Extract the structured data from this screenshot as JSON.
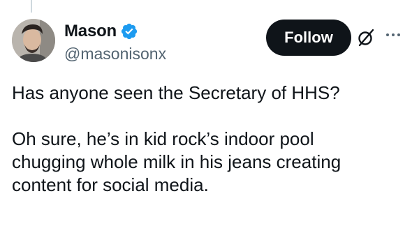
{
  "author": {
    "display_name": "Mason",
    "handle": "@masonisonx",
    "verified": true
  },
  "actions": {
    "follow_label": "Follow"
  },
  "icons": {
    "verified": "verified-badge-icon",
    "grok": "grok-icon",
    "more": "more-horizontal-icon"
  },
  "tweet": {
    "paragraph1": [
      "Has anyone seen the Secretary of HHS?"
    ],
    "paragraph2": [
      "Oh sure, he’s in kid rock’s indoor pool",
      "chugging whole milk in his jeans creating",
      "content for social media."
    ]
  },
  "colors": {
    "text": "#0f1419",
    "secondary": "#536471",
    "verified": "#1d9bf0",
    "button_bg": "#0f1419"
  }
}
